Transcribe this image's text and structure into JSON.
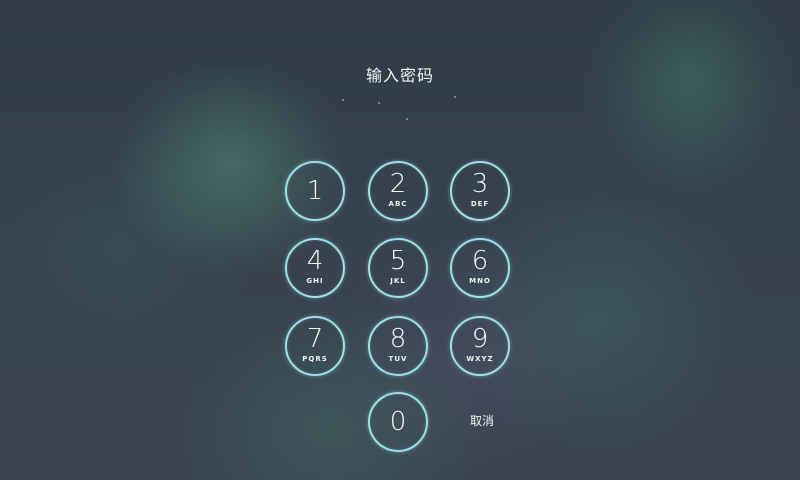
{
  "title": "输入密码",
  "keypad": [
    {
      "digit": "1",
      "letters": ""
    },
    {
      "digit": "2",
      "letters": "ABC"
    },
    {
      "digit": "3",
      "letters": "DEF"
    },
    {
      "digit": "4",
      "letters": "GHI"
    },
    {
      "digit": "5",
      "letters": "JKL"
    },
    {
      "digit": "6",
      "letters": "MNO"
    },
    {
      "digit": "7",
      "letters": "PQRS"
    },
    {
      "digit": "8",
      "letters": "TUV"
    },
    {
      "digit": "9",
      "letters": "WXYZ"
    },
    {
      "digit": "0",
      "letters": ""
    }
  ],
  "cancel_label": "取消",
  "colors": {
    "background": "#34404c",
    "key_ring": "#9fe0e6",
    "text": "#f4f8fa"
  }
}
